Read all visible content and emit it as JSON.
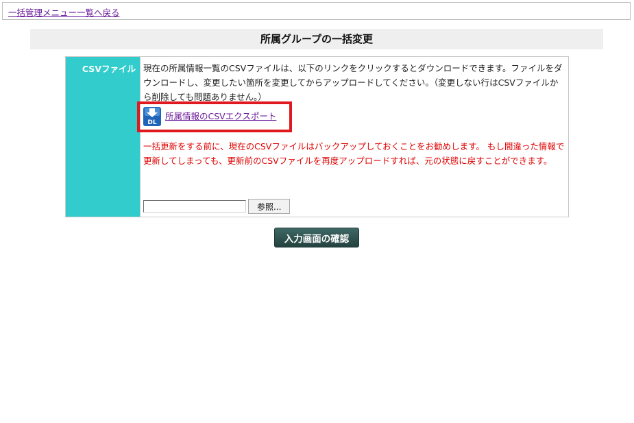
{
  "nav": {
    "back_link": "一括管理メニュー一覧へ戻る"
  },
  "page": {
    "title": "所属グループの一括変更"
  },
  "form": {
    "label": "CSVファイル",
    "description": "現在の所属情報一覧のCSVファイルは、以下のリンクをクリックするとダウンロードできます。ファイルをダウンロードし、変更したい箇所を変更してからアップロードしてください。（変更しない行はCSVファイルから削除しても問題ありません。）",
    "download_icon_text": "DL",
    "download_link": "所属情報のCSVエクスポート",
    "warning": "一括更新をする前に、現在のCSVファイルはバックアップしておくことをお勧めします。 もし間違った情報で更新してしまっても、更新前のCSVファイルを再度アップロードすれば、元の状態に戻すことができます。",
    "file_input_value": "",
    "browse_label": "参照..."
  },
  "actions": {
    "confirm_label": "入力画面の確認"
  },
  "colors": {
    "label_bg": "#33cccc",
    "highlight": "#e0191e",
    "warning_text": "#e00000",
    "confirm_bg": "#2f5451"
  },
  "icons": {
    "download": "download-icon"
  }
}
